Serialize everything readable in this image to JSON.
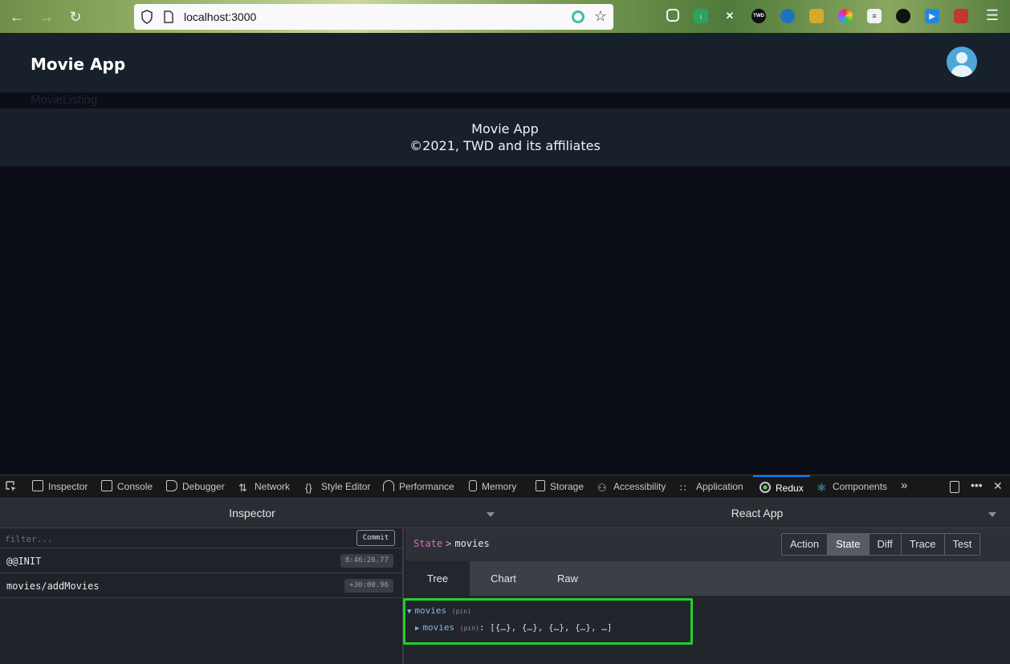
{
  "browser": {
    "url": "localhost:3000"
  },
  "app": {
    "title": "Movie App",
    "listing_label": "MovieListing",
    "footer_line1": "Movie App",
    "footer_line2": "©2021, TWD and its affiliates"
  },
  "devtools": {
    "tabs": [
      {
        "label": "Inspector",
        "icon": "inspector-icon"
      },
      {
        "label": "Console",
        "icon": "console-icon"
      },
      {
        "label": "Debugger",
        "icon": "debugger-icon"
      },
      {
        "label": "Network",
        "icon": "network-icon"
      },
      {
        "label": "Style Editor",
        "icon": "style-editor-icon"
      },
      {
        "label": "Performance",
        "icon": "performance-icon"
      },
      {
        "label": "Memory",
        "icon": "memory-icon"
      },
      {
        "label": "Storage",
        "icon": "storage-icon"
      },
      {
        "label": "Accessibility",
        "icon": "accessibility-icon"
      },
      {
        "label": "Application",
        "icon": "application-icon"
      },
      {
        "label": "Redux",
        "icon": "redux-icon"
      },
      {
        "label": "Components",
        "icon": "react-icon"
      }
    ],
    "active_tab": "Redux"
  },
  "redux": {
    "left_dropdown": "Inspector",
    "right_dropdown": "React App",
    "filter_placeholder": "filter...",
    "commit_label": "Commit",
    "actions": [
      {
        "name": "@@INIT",
        "time": "8:46:26.77"
      },
      {
        "name": "movies/addMovies",
        "time": "+30:00.96"
      }
    ],
    "breadcrumb": {
      "root": "State",
      "separator": ">",
      "path": "movies"
    },
    "modes": [
      "Action",
      "State",
      "Diff",
      "Trace",
      "Test"
    ],
    "active_mode": "State",
    "view_tabs": [
      "Tree",
      "Chart",
      "Raw"
    ],
    "active_view": "Tree",
    "tree": {
      "root_key": "movies",
      "root_pin": "(pin)",
      "child_key": "movies",
      "child_pin": "(pin)",
      "child_value": ": [{…}, {…}, {…}, {…}, …]"
    }
  }
}
